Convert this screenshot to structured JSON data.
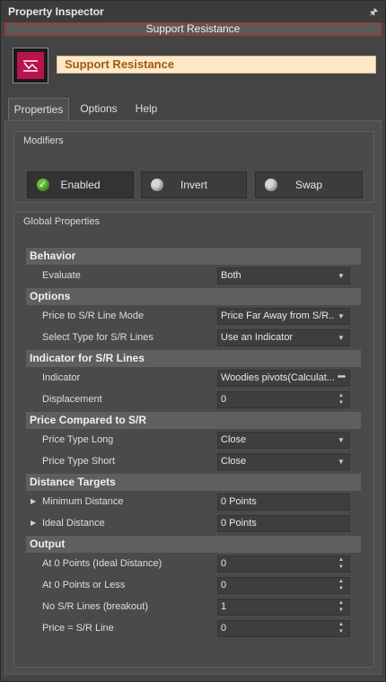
{
  "window": {
    "title": "Property Inspector",
    "pin_icon": "pin-icon"
  },
  "object": {
    "name_bar": "Support Resistance",
    "name": "Support Resistance",
    "icon_color": "#b8134e"
  },
  "tabs": [
    {
      "label": "Properties",
      "active": true
    },
    {
      "label": "Options",
      "active": false
    },
    {
      "label": "Help",
      "active": false
    }
  ],
  "modifiers": {
    "title": "Modifiers",
    "buttons": [
      {
        "label": "Enabled",
        "state": "on"
      },
      {
        "label": "Invert",
        "state": "off"
      },
      {
        "label": "Swap",
        "state": "off"
      }
    ]
  },
  "global": {
    "title": "Global Properties",
    "sections": [
      {
        "title": "Behavior",
        "rows": [
          {
            "label": "Evaluate",
            "value": "Both",
            "control": "dropdown"
          }
        ]
      },
      {
        "title": "Options",
        "rows": [
          {
            "label": "Price to S/R Line Mode",
            "value": "Price Far Away from S/R...",
            "control": "dropdown"
          },
          {
            "label": "Select Type for S/R Lines",
            "value": "Use an Indicator",
            "control": "dropdown"
          }
        ]
      },
      {
        "title": "Indicator for S/R Lines",
        "rows": [
          {
            "label": "Indicator",
            "value": "Woodies pivots(Calculat...",
            "control": "ellipsis"
          },
          {
            "label": "Displacement",
            "value": "0",
            "control": "spinner"
          }
        ]
      },
      {
        "title": "Price Compared to S/R",
        "rows": [
          {
            "label": "Price Type Long",
            "value": "Close",
            "control": "dropdown"
          },
          {
            "label": "Price Type Short",
            "value": "Close",
            "control": "dropdown"
          }
        ]
      },
      {
        "title": "Distance Targets",
        "rows": [
          {
            "label": "Minimum Distance",
            "value": "0 Points",
            "control": "none",
            "expandable": true
          },
          {
            "label": "Ideal Distance",
            "value": "0 Points",
            "control": "none",
            "expandable": true
          }
        ]
      },
      {
        "title": "Output",
        "rows": [
          {
            "label": "At 0 Points (Ideal Distance)",
            "value": "0",
            "control": "spinner"
          },
          {
            "label": "At 0 Points or Less",
            "value": "0",
            "control": "spinner"
          },
          {
            "label": "No S/R Lines (breakout)",
            "value": "1",
            "control": "spinner"
          },
          {
            "label": "Price = S/R Line",
            "value": "0",
            "control": "spinner"
          }
        ]
      }
    ]
  }
}
